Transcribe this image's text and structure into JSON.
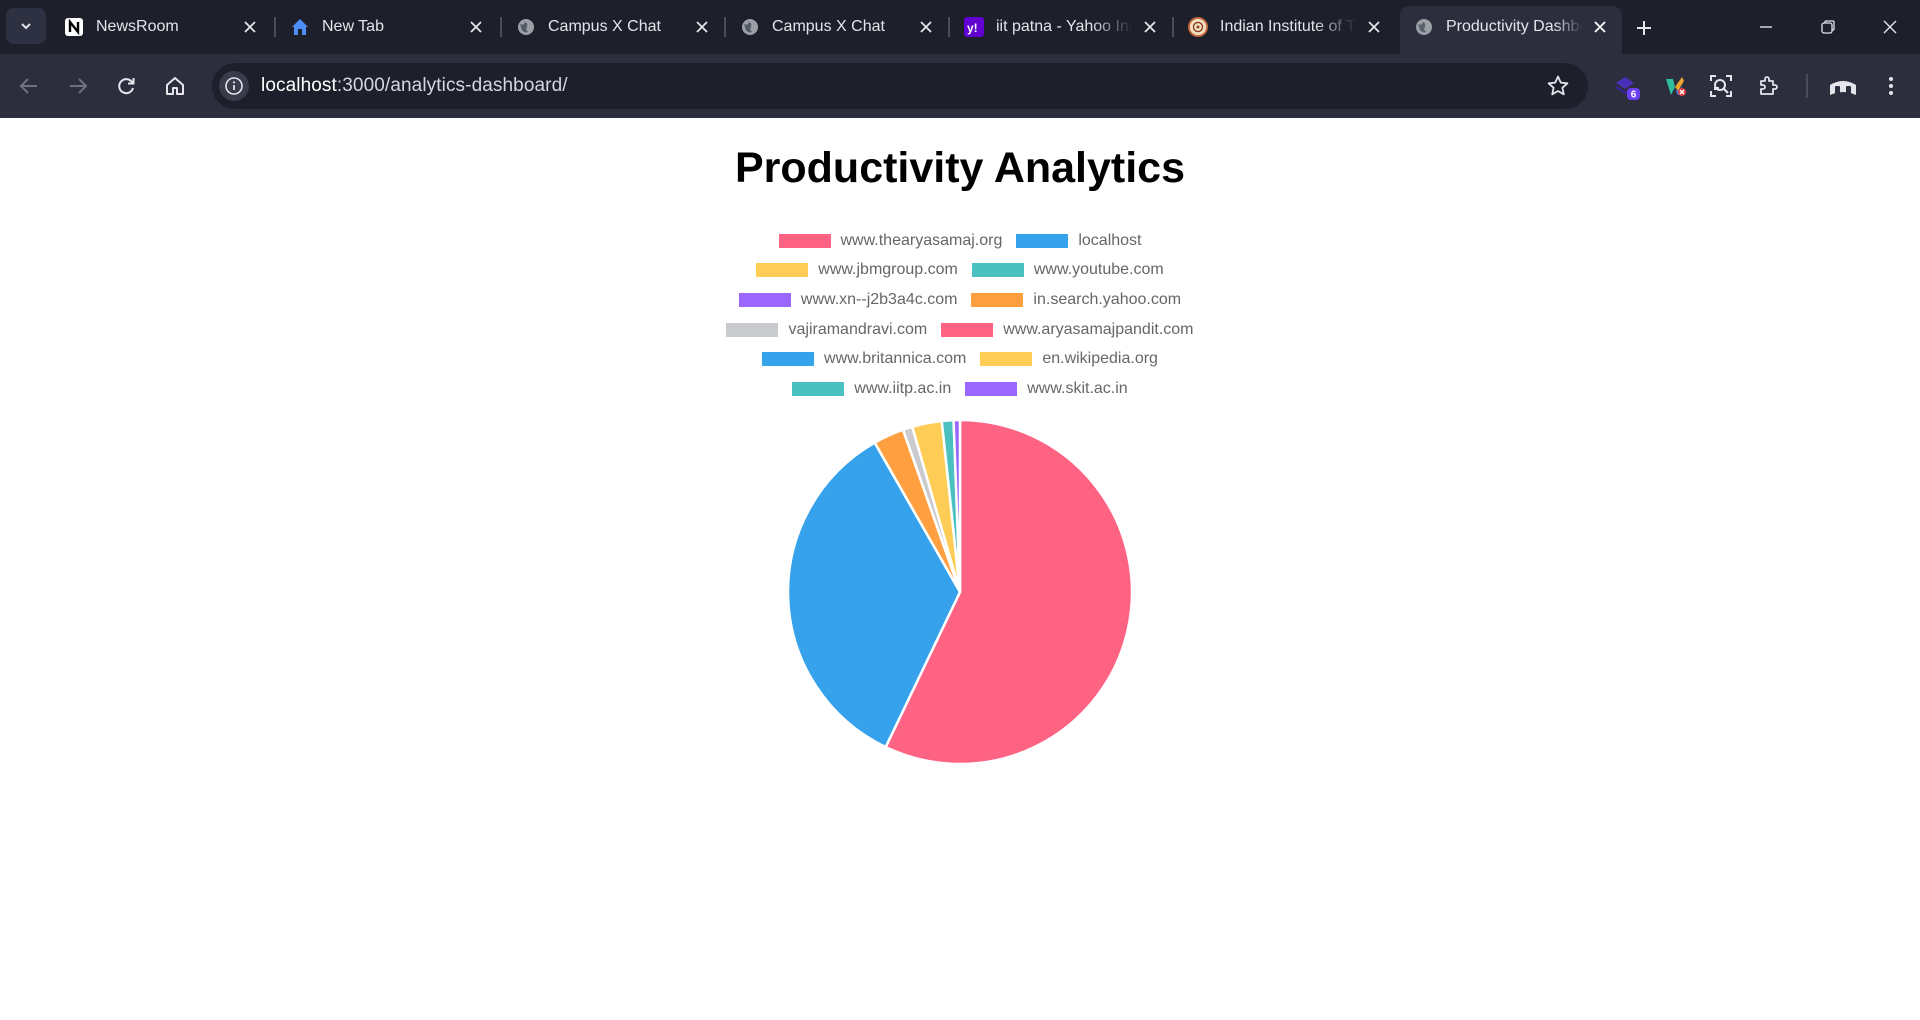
{
  "browser": {
    "tabs": [
      {
        "title": "NewsRoom",
        "icon": "notion-icon"
      },
      {
        "title": "New Tab",
        "icon": "home-icon"
      },
      {
        "title": "Campus X Chat",
        "icon": "globe-icon"
      },
      {
        "title": "Campus X Chat",
        "icon": "globe-icon"
      },
      {
        "title": "iit patna - Yahoo India",
        "icon": "yahoo-icon"
      },
      {
        "title": "Indian Institute of Technology",
        "icon": "institute-logo-icon"
      },
      {
        "title": "Productivity Dashboard",
        "icon": "globe-icon",
        "active": true
      }
    ],
    "address": {
      "host": "localhost",
      "path": ":3000/analytics-dashboard/"
    },
    "extension_badge": "6"
  },
  "page": {
    "title": "Productivity Analytics"
  },
  "chart_data": {
    "type": "pie",
    "title": "",
    "labels": [
      "www.thearyasamaj.org",
      "localhost",
      "www.jbmgroup.com",
      "www.youtube.com",
      "www.xn--j2b3a4c.com",
      "in.search.yahoo.com",
      "vajiramandravi.com",
      "www.aryasamajpandit.com",
      "www.britannica.com",
      "en.wikipedia.org",
      "www.iitp.ac.in",
      "www.skit.ac.in"
    ],
    "values": [
      57.4,
      34.8,
      0.0,
      0.0,
      0.0,
      2.9,
      0.9,
      0.0,
      0.0,
      2.8,
      1.1,
      0.6
    ],
    "colors": [
      "#ff6384",
      "#36a2eb",
      "#ffcd56",
      "#4bc0c0",
      "#9966ff",
      "#ff9f40",
      "#c9cbcf",
      "#ff6384",
      "#36a2eb",
      "#ffcd56",
      "#4bc0c0",
      "#9966ff"
    ],
    "legend_position": "top"
  }
}
